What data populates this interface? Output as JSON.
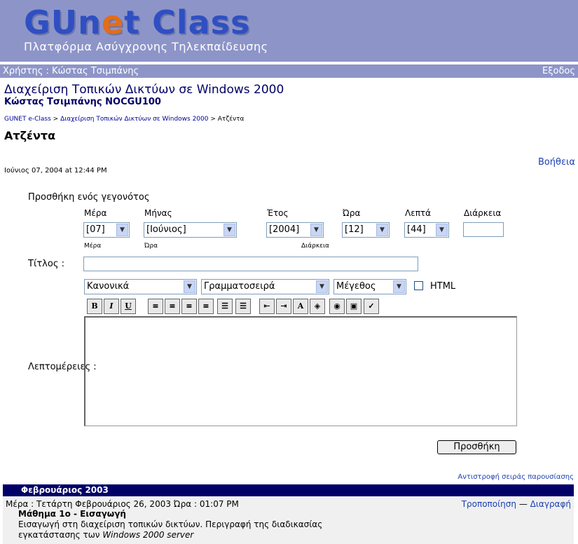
{
  "banner": {
    "logo_part1": "GUn",
    "logo_part2": "e",
    "logo_part3": "t Class",
    "subtitle": "Πλατφόρμα Ασύγχρονης Τηλεκπαίδευσης"
  },
  "userbar": {
    "user": "Χρήστης : Κώστας Τσιμπάνης",
    "logout": "Εξοδος"
  },
  "course": {
    "title": "Διαχείριση Τοπικών Δικτύων σε Windows 2000",
    "subtitle": "Κώστας Τσιμπάνης NOCGU100"
  },
  "breadcrumb": {
    "home": "GUNET e-Class",
    "sep1": " > ",
    "course": "Διαχείριση Τοπικών Δικτύων σε Windows 2000",
    "sep2": " > ",
    "current": "Ατζέντα"
  },
  "page_title": "Ατζέντα",
  "help_link": "Βοήθεια",
  "current_datetime": "Ιούνιος 07, 2004 at 12:44 PM",
  "form": {
    "heading": "Προσθήκη ενός γεγονότος",
    "labels": {
      "day": "Μέρα",
      "month": "Μήνας",
      "year": "Έτος",
      "hour": "Ώρα",
      "minute": "Λεπτά",
      "duration": "Διάρκεια"
    },
    "small_labels": {
      "day": "Μέρα",
      "hour": "Ώρα",
      "duration": "Διάρκεια"
    },
    "values": {
      "day": "[07]",
      "month": "[Ιούνιος]",
      "year": "[2004]",
      "hour": "[12]",
      "minute": "[44]",
      "duration": ""
    },
    "title_label": "Τίτλος :",
    "details_label": "Λεπτομέρειες :",
    "submit": "Προσθήκη"
  },
  "editor": {
    "format": "Κανονικά",
    "font": "Γραμματοσειρά",
    "size": "Μέγεθος",
    "html_label": "HTML",
    "buttons": [
      "B",
      "I",
      "U",
      "≡",
      "≡",
      "≡",
      "≡",
      "☰",
      "☰",
      "⇤",
      "⇥",
      "A",
      "◈",
      "◉",
      "▣",
      "✓"
    ]
  },
  "reverse_order": "Αντιστροφή σειράς παρουσίασης",
  "month_header": "Φεβρουάριος 2003",
  "event": {
    "day_line": "Μέρα : Τετάρτη Φεβρουάριος 26, 2003  Ώρα : 01:07 PM",
    "edit": "Τροποποίηση",
    "dash": " — ",
    "delete": "Διαγραφή",
    "title": "Μάθημα 1ο - Εισαγωγή",
    "desc_line1": "Εισαγωγή στη διαχείριση τοπικών δικτύων. Περιγραφή της διαδικασίας",
    "desc_line2_prefix": "εγκατάστασης των ",
    "desc_line2_italic": "Windows 2000 server"
  },
  "colors": {
    "banner": "#8d95c8",
    "logo_blue": "#2f4fc2",
    "logo_orange": "#e36d1a",
    "month_bar": "#000066",
    "link": "#1a3fb0"
  }
}
